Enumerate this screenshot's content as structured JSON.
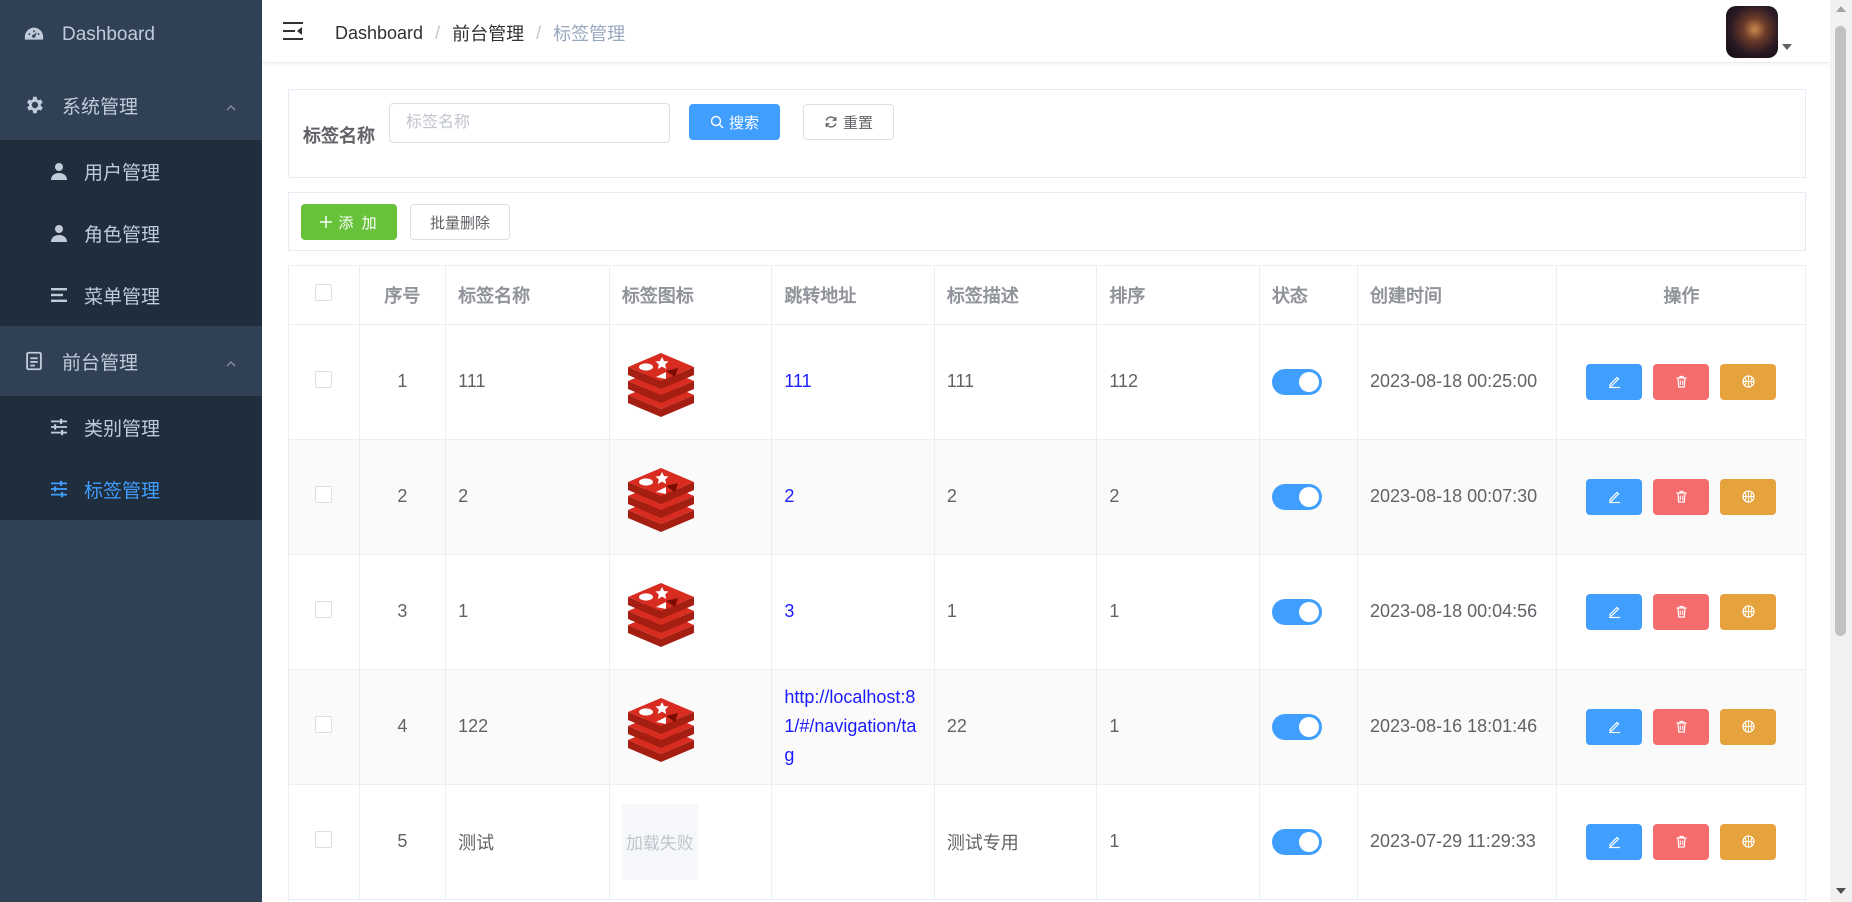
{
  "sidebar": {
    "dashboard": "Dashboard",
    "system": "系统管理",
    "system_items": [
      "用户管理",
      "角色管理",
      "菜单管理"
    ],
    "frontend": "前台管理",
    "frontend_items": [
      "类别管理",
      "标签管理"
    ],
    "active_item": "标签管理",
    "background": "#304156",
    "active_color": "#409eff"
  },
  "header": {
    "breadcrumb": [
      "Dashboard",
      "前台管理",
      "标签管理"
    ],
    "sep": "/"
  },
  "search": {
    "label": "标签名称",
    "placeholder": "标签名称",
    "value": "",
    "search_btn": "搜索",
    "reset_btn": "重置"
  },
  "toolbar": {
    "add_btn": "添 加",
    "batch_delete_btn": "批量删除"
  },
  "table": {
    "headers": [
      "序号",
      "标签名称",
      "标签图标",
      "跳转地址",
      "标签描述",
      "排序",
      "状态",
      "创建时间",
      "操作"
    ],
    "rows": [
      {
        "index": "1",
        "name": "111",
        "icon": "redis-logo",
        "url": "111",
        "desc": "111",
        "sort": "112",
        "status": true,
        "created": "2023-08-18 00:25:00"
      },
      {
        "index": "2",
        "name": "2",
        "icon": "redis-logo",
        "url": "2",
        "desc": "2",
        "sort": "2",
        "status": true,
        "created": "2023-08-18 00:07:30"
      },
      {
        "index": "3",
        "name": "1",
        "icon": "redis-logo",
        "url": "3",
        "desc": "1",
        "sort": "1",
        "status": true,
        "created": "2023-08-18 00:04:56"
      },
      {
        "index": "4",
        "name": "122",
        "icon": "redis-logo",
        "url": "http://localhost:81/#/navigation/tag",
        "desc": "22",
        "sort": "1",
        "status": true,
        "created": "2023-08-16 18:01:46"
      },
      {
        "index": "5",
        "name": "测试",
        "icon": "load-failed",
        "icon_text": "加载失败",
        "url": "",
        "desc": "测试专用",
        "sort": "1",
        "status": true,
        "created": "2023-07-29 11:29:33"
      }
    ]
  }
}
